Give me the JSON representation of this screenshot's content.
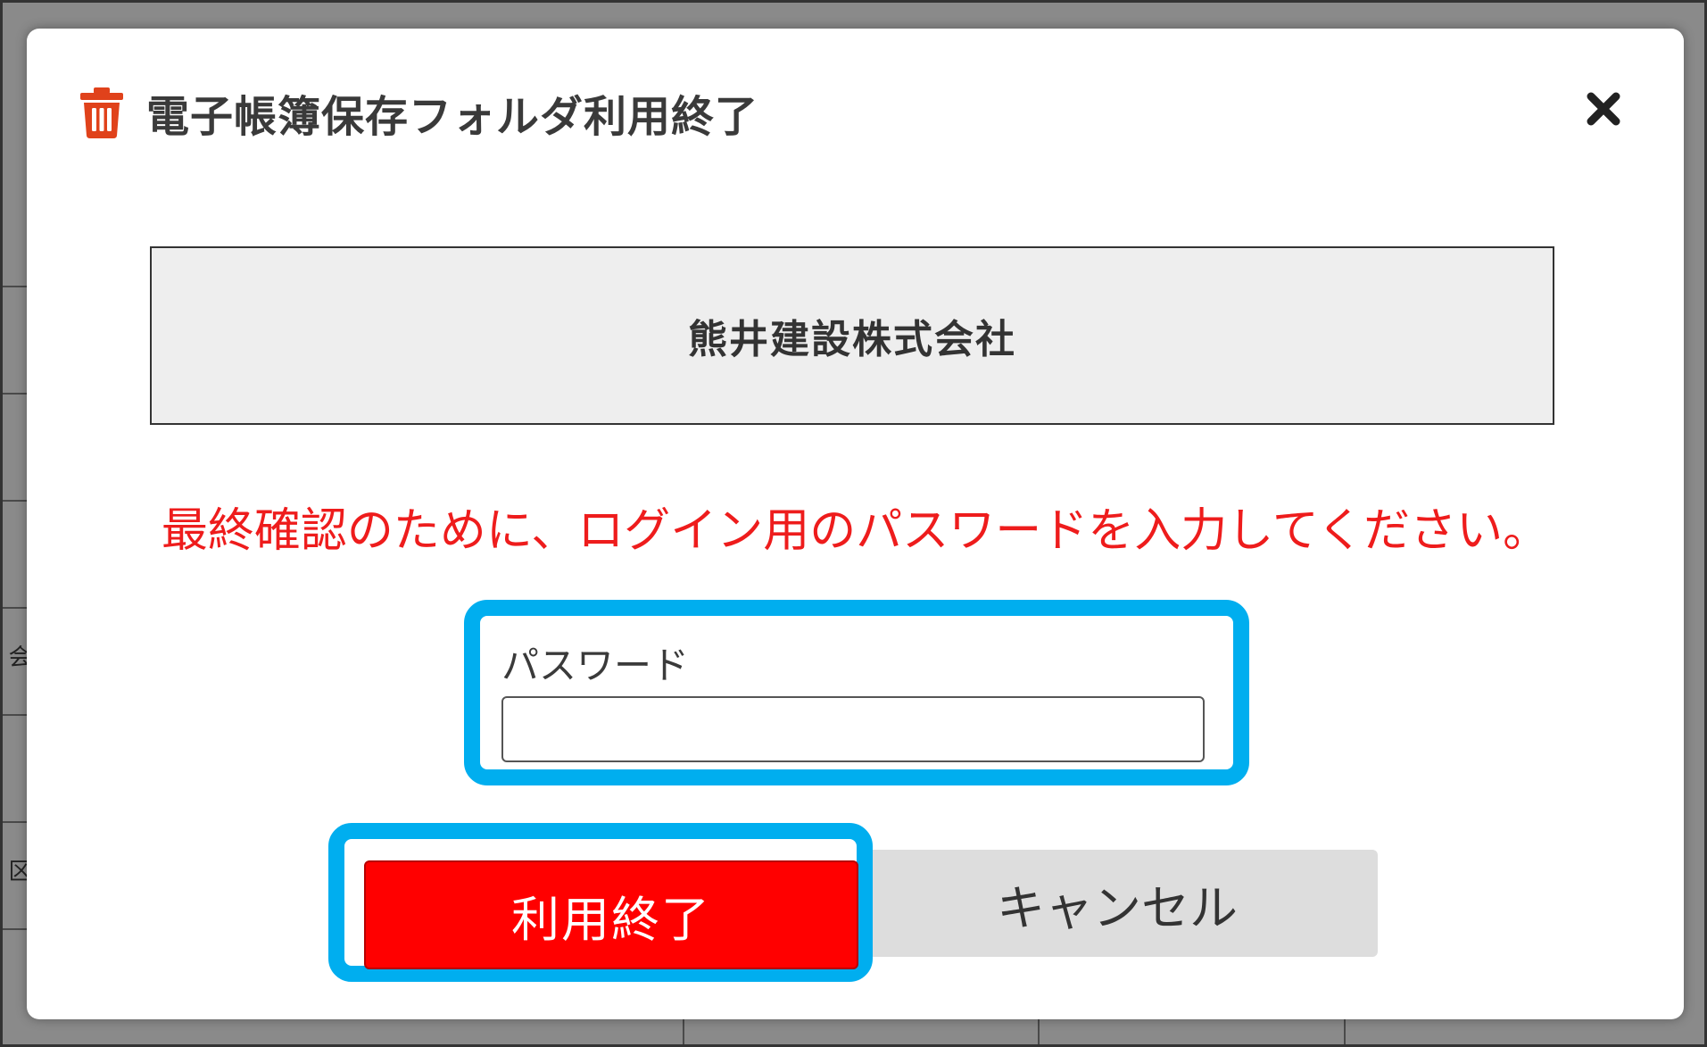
{
  "dialog": {
    "title": "電子帳簿保存フォルダ利用終了",
    "title_icon": "trash-icon",
    "close_icon": "close-icon",
    "company_name": "熊井建設株式会社",
    "warning": "最終確認のために、ログイン用のパスワードを入力してください。",
    "password": {
      "label": "パスワード",
      "value": "",
      "placeholder": ""
    },
    "buttons": {
      "end_label": "利用終了",
      "cancel_label": "キャンセル"
    }
  },
  "colors": {
    "accent_icon": "#e0421b",
    "warning_text": "#ee1c1c",
    "highlight_frame": "#00aeef",
    "primary_button": "#ff0000",
    "secondary_button": "#dddddd"
  },
  "background": {
    "side_glyphs": [
      "会",
      "区"
    ]
  }
}
